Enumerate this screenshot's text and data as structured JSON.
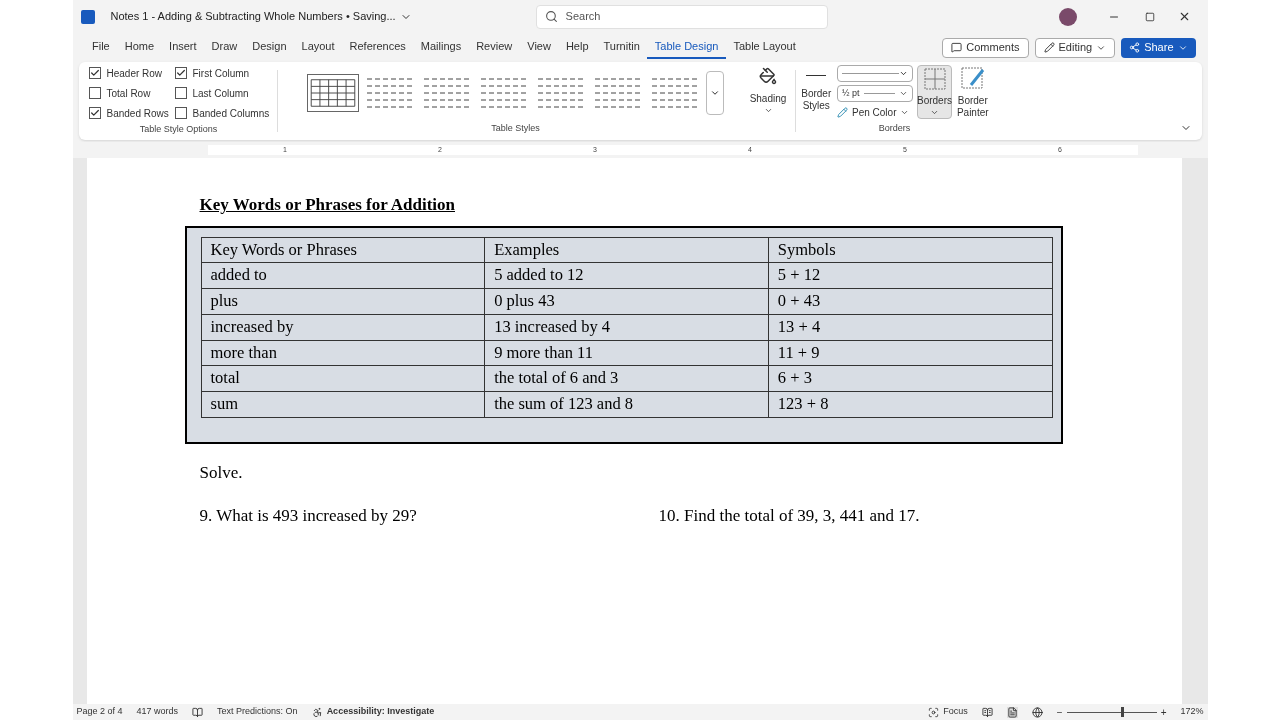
{
  "title_bar": {
    "title": "Notes 1 - Adding & Subtracting Whole Numbers • Saving...",
    "search_placeholder": "Search"
  },
  "menu_tabs": [
    {
      "label": "File",
      "selected": false
    },
    {
      "label": "Home",
      "selected": false
    },
    {
      "label": "Insert",
      "selected": false
    },
    {
      "label": "Draw",
      "selected": false
    },
    {
      "label": "Design",
      "selected": false
    },
    {
      "label": "Layout",
      "selected": false
    },
    {
      "label": "References",
      "selected": false
    },
    {
      "label": "Mailings",
      "selected": false
    },
    {
      "label": "Review",
      "selected": false
    },
    {
      "label": "View",
      "selected": false
    },
    {
      "label": "Help",
      "selected": false
    },
    {
      "label": "Turnitin",
      "selected": false
    },
    {
      "label": "Table Design",
      "selected": true
    },
    {
      "label": "Table Layout",
      "selected": false
    }
  ],
  "actions": {
    "comments": "Comments",
    "editing": "Editing",
    "share": "Share"
  },
  "style_options": {
    "items": [
      {
        "label": "Header Row",
        "checked": true
      },
      {
        "label": "Total Row",
        "checked": false
      },
      {
        "label": "Banded Rows",
        "checked": true
      },
      {
        "label": "First Column",
        "checked": true
      },
      {
        "label": "Last Column",
        "checked": false
      },
      {
        "label": "Banded Columns",
        "checked": false
      }
    ],
    "group_label": "Table Style Options"
  },
  "table_styles": {
    "styles": [
      {
        "selected": true
      },
      {
        "selected": false
      },
      {
        "selected": false
      },
      {
        "selected": false
      },
      {
        "selected": false
      },
      {
        "selected": false
      },
      {
        "selected": false
      }
    ],
    "group_label": "Table Styles"
  },
  "shading": {
    "label": "Shading"
  },
  "borders_group": {
    "border_styles": "Border Styles",
    "pen_weight": "½ pt",
    "pen_color": "Pen Color",
    "borders": "Borders",
    "border_painter": "Border Painter",
    "group_label": "Borders"
  },
  "ruler": [
    "1",
    "2",
    "3",
    "4",
    "5",
    "6"
  ],
  "document": {
    "heading": "Key Words or Phrases for Addition",
    "table": {
      "columns": [
        "Key Words or Phrases",
        "Examples",
        "Symbols"
      ],
      "rows": [
        [
          "added to",
          "5 added to 12",
          "5 + 12"
        ],
        [
          "plus",
          "0 plus 43",
          "0 + 43"
        ],
        [
          "increased by",
          "13 increased by 4",
          "13 + 4"
        ],
        [
          "more than",
          "9 more than 11",
          "11 + 9"
        ],
        [
          "total",
          "the total of 6 and 3",
          "6 + 3"
        ],
        [
          "sum",
          "the sum of 123 and 8",
          "123 + 8"
        ]
      ]
    },
    "solve": "Solve.",
    "questions": [
      "9. What is 493 increased by 29?",
      "10. Find the total of 39, 3, 441 and 17."
    ]
  },
  "status_bar": {
    "page": "Page 2 of 4",
    "words": "417 words",
    "predictions": "Text Predictions: On",
    "accessibility": "Accessibility: Investigate",
    "focus": "Focus",
    "zoom": {
      "level": 0.6,
      "minus": "−",
      "plus": "+"
    },
    "zoom_text": "172%"
  }
}
